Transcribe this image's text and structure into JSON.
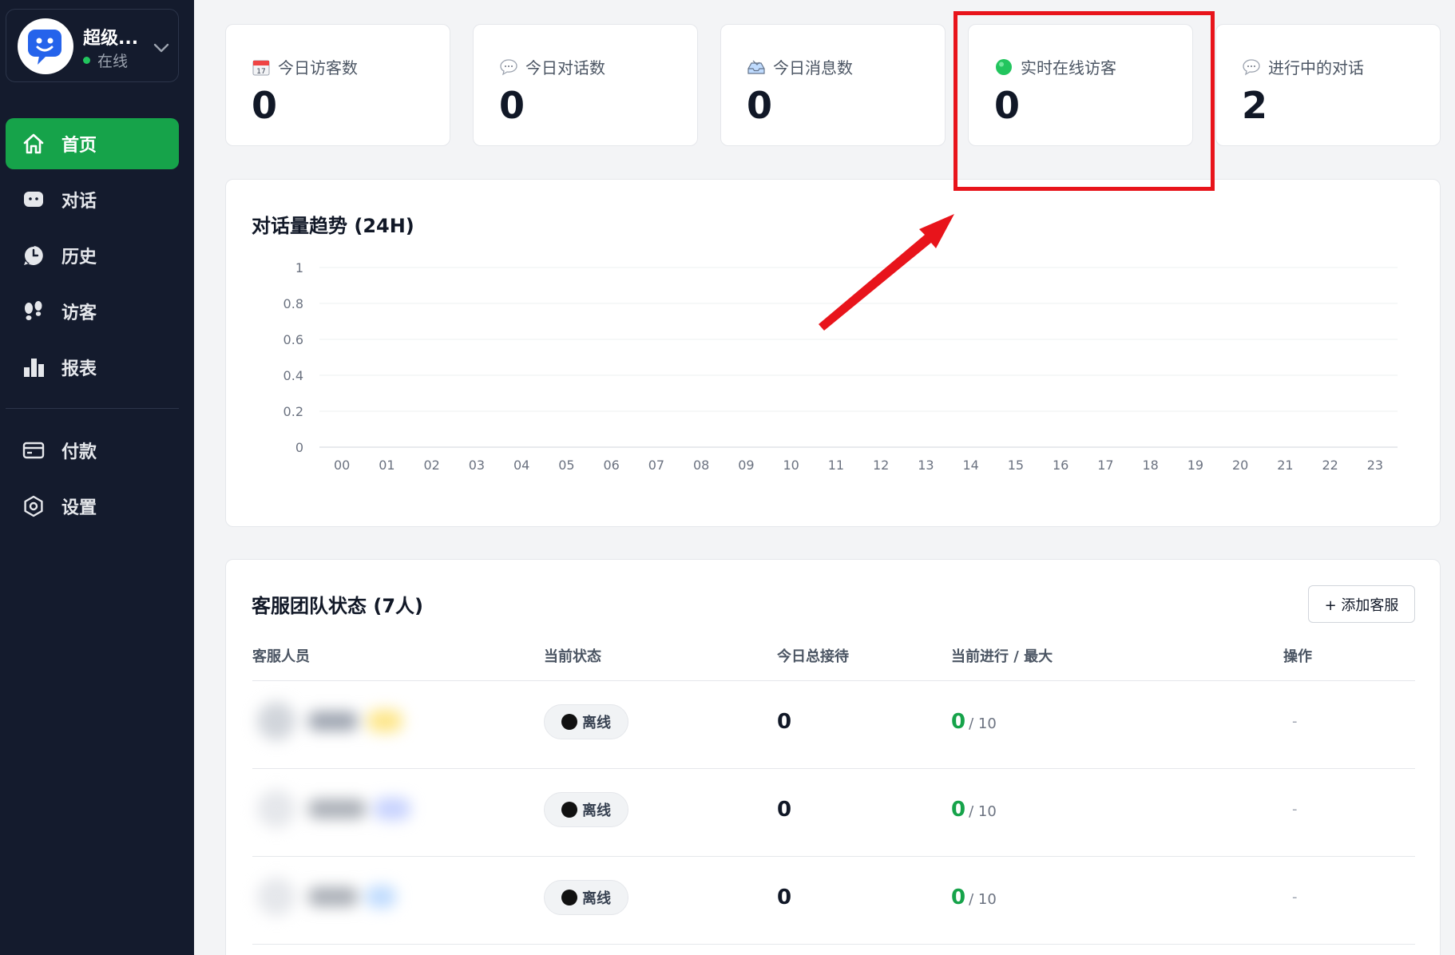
{
  "sidebar": {
    "profile": {
      "name": "超级...",
      "status": "在线"
    },
    "items": [
      {
        "label": "首页",
        "icon": "home-icon",
        "active": true
      },
      {
        "label": "对话",
        "icon": "chat-icon"
      },
      {
        "label": "历史",
        "icon": "history-icon"
      },
      {
        "label": "访客",
        "icon": "footprints-icon"
      },
      {
        "label": "报表",
        "icon": "bar-chart-icon"
      },
      {
        "label": "付款",
        "icon": "credit-card-icon"
      },
      {
        "label": "设置",
        "icon": "settings-icon"
      }
    ]
  },
  "stats": [
    {
      "label": "今日访客数",
      "value": "0",
      "icon": "calendar-icon"
    },
    {
      "label": "今日对话数",
      "value": "0",
      "icon": "speech-bubble-icon"
    },
    {
      "label": "今日消息数",
      "value": "0",
      "icon": "inbox-tray-icon"
    },
    {
      "label": "实时在线访客",
      "value": "0",
      "icon": "green-circle-icon"
    },
    {
      "label": "进行中的对话",
      "value": "2",
      "icon": "speech-bubble-icon"
    }
  ],
  "chart": {
    "title": "对话量趋势 (24H)"
  },
  "chart_data": {
    "type": "line",
    "x": [
      "00",
      "01",
      "02",
      "03",
      "04",
      "05",
      "06",
      "07",
      "08",
      "09",
      "10",
      "11",
      "12",
      "13",
      "14",
      "15",
      "16",
      "17",
      "18",
      "19",
      "20",
      "21",
      "22",
      "23"
    ],
    "yticks": [
      "1",
      "0.8",
      "0.6",
      "0.4",
      "0.2",
      "0"
    ],
    "series": [],
    "ylim": [
      0,
      1
    ],
    "grid": true
  },
  "team": {
    "title": "客服团队状态 (7人)",
    "add_button": "+ 添加客服",
    "columns": [
      "客服人员",
      "当前状态",
      "今日总接待",
      "当前进行 / 最大",
      "操作"
    ],
    "rows": [
      {
        "status": "离线",
        "total": "0",
        "current": "0",
        "max": "/ 10",
        "action": "-"
      },
      {
        "status": "离线",
        "total": "0",
        "current": "0",
        "max": "/ 10",
        "action": "-"
      },
      {
        "status": "离线",
        "total": "0",
        "current": "0",
        "max": "/ 10",
        "action": "-"
      }
    ]
  },
  "colors": {
    "sidebar_bg": "#141b2d",
    "accent_green": "#16a34a",
    "annotation_red": "#e8141b"
  }
}
